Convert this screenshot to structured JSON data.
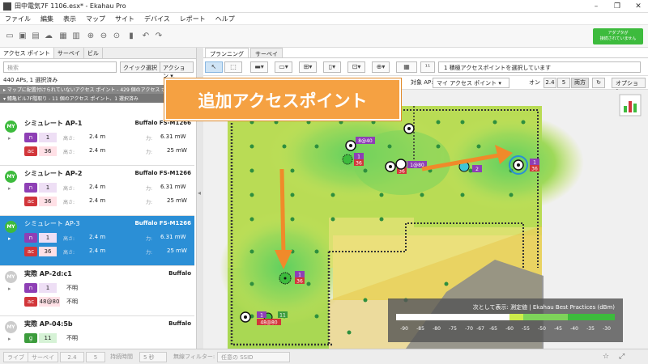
{
  "window": {
    "title": "田中電気7F 1106.esx* - Ekahau Pro",
    "controls": [
      "–",
      "❐",
      "✕"
    ]
  },
  "menu": [
    "ファイル",
    "編集",
    "表示",
    "マップ",
    "サイト",
    "デバイス",
    "レポート",
    "ヘルプ"
  ],
  "adapter": {
    "line1": "アダプタが",
    "line2": "接続されていません"
  },
  "left": {
    "tabs": [
      "アクセス ポイント",
      "サーベイ",
      "ビル"
    ],
    "search_placeholder": "検索",
    "quick_select": "クイック選択",
    "action": "アクション",
    "count": "440 APs, 1 選択済み",
    "all": "すべての",
    "group1": "▸ マップに配置付けられていないアクセス ポイント - 429 個のアクセス ポイント、1 選択済み",
    "group2": "▾ 鯖亀ビル7F階取り - 11 個のアクセス ポイント、1 選択済み",
    "labels": {
      "height": "高さ:",
      "power": "力:"
    },
    "aps": [
      {
        "badge": "MY",
        "name": "シミュレート AP-1",
        "model": "Buffalo FS-M1266",
        "r1": "n",
        "r1v": "1",
        "r2": "ac",
        "r2v": "36",
        "height": "2.4 m",
        "power": "6.31 mW",
        "power2": "25 mW"
      },
      {
        "badge": "MY",
        "name": "シミュレート AP-2",
        "model": "Buffalo FS-M1266",
        "r1": "n",
        "r1v": "1",
        "r2": "ac",
        "r2v": "36",
        "height": "2.4 m",
        "power": "6.31 mW",
        "power2": "25 mW"
      },
      {
        "badge": "MY",
        "name": "シミュレート AP-3",
        "model": "Buffalo FS-M1266",
        "r1": "n",
        "r1v": "1",
        "r2": "ac",
        "r2v": "36",
        "height": "2.4 m",
        "power": "6.31 mW",
        "power2": "25 mW"
      },
      {
        "badge": "MY",
        "name": "実際 AP-2d:c1",
        "model": "Buffalo",
        "r1": "n",
        "r1v": "1",
        "r2": "ac",
        "r2v": "48@80",
        "height": "不明"
      },
      {
        "badge": "MY",
        "name": "実際 AP-04:5b",
        "model": "Buffalo",
        "r1": "g",
        "r1v": "11",
        "height": "不明"
      }
    ]
  },
  "right": {
    "tabs": [
      "プランニング",
      "サーベイ"
    ],
    "ap_select": "1 積極アクセスポイントを選択しています",
    "target_label": "対象 AP:",
    "target_value": "マイ アクセス ポイント",
    "on_label": "オン",
    "bands": [
      "2.4",
      "5",
      "両方"
    ],
    "option": "オプション"
  },
  "callout": "追加アクセスポイント",
  "legend": {
    "title": "次として表示: 測定値 | Ekahau Best Practices (dBm)",
    "ticks": [
      "-90",
      "-85",
      "-80",
      "-75",
      "-70",
      "-67",
      "-65",
      "-60",
      "-55",
      "-50",
      "-45",
      "-40",
      "-35",
      "-30"
    ]
  },
  "map_labels": {
    "l1a": "1",
    "l1b": "36",
    "l2a": "8@40",
    "l3a": "1",
    "l3b": "36",
    "l4a": "1@80",
    "l5a": "2",
    "l6a": "1",
    "l6b": "36",
    "l7a": "1",
    "l7b": "36",
    "l8a": "1",
    "l8b": "11",
    "l8c": "48@80"
  },
  "status": {
    "live": "ライブ",
    "survey": "サーベイ",
    "b24": "2.4",
    "b5": "5",
    "duration": "持続時間",
    "duration_val": "5 秒",
    "filter": "無線フィルター:",
    "filter_val": "任意の SSID"
  },
  "colors": {
    "selected": "#2b8fd6",
    "accent": "#f5a142",
    "green": "#3dbb3d"
  }
}
